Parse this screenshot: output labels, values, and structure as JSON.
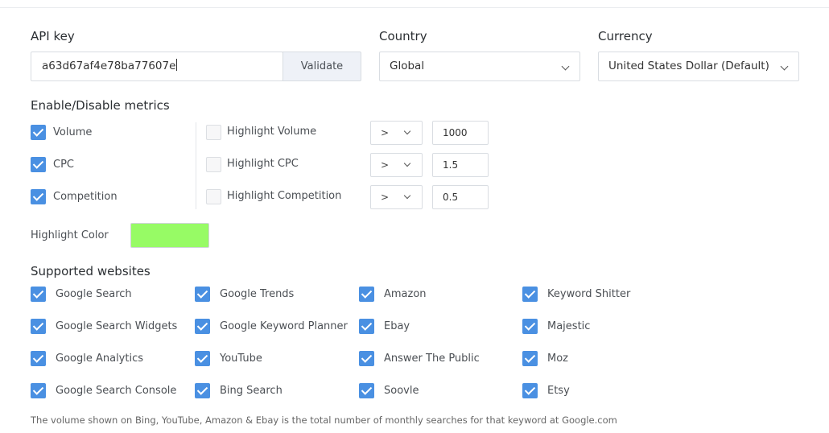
{
  "api": {
    "title": "API key",
    "value": "a63d67af4e78ba77607e",
    "validate_label": "Validate"
  },
  "country": {
    "title": "Country",
    "selected": "Global"
  },
  "currency": {
    "title": "Currency",
    "selected": "United States Dollar (Default)"
  },
  "metrics": {
    "title": "Enable/Disable metrics",
    "items": [
      {
        "label": "Volume",
        "checked": true,
        "highlight_label": "Highlight Volume",
        "highlight_checked": false,
        "operator": ">",
        "threshold": "1000"
      },
      {
        "label": "CPC",
        "checked": true,
        "highlight_label": "Highlight CPC",
        "highlight_checked": false,
        "operator": ">",
        "threshold": "1.5"
      },
      {
        "label": "Competition",
        "checked": true,
        "highlight_label": "Highlight Competition",
        "highlight_checked": false,
        "operator": ">",
        "threshold": "0.5"
      }
    ]
  },
  "highlight_color": {
    "label": "Highlight Color",
    "value": "#97fb65"
  },
  "websites": {
    "title": "Supported websites",
    "columns": [
      [
        {
          "label": "Google Search",
          "checked": true
        },
        {
          "label": "Google Search Widgets",
          "checked": true
        },
        {
          "label": "Google Analytics",
          "checked": true
        },
        {
          "label": "Google Search Console",
          "checked": true
        }
      ],
      [
        {
          "label": "Google Trends",
          "checked": true
        },
        {
          "label": "Google Keyword Planner",
          "checked": true
        },
        {
          "label": "YouTube",
          "checked": true
        },
        {
          "label": "Bing Search",
          "checked": true
        }
      ],
      [
        {
          "label": "Amazon",
          "checked": true
        },
        {
          "label": "Ebay",
          "checked": true
        },
        {
          "label": "Answer The Public",
          "checked": true
        },
        {
          "label": "Soovle",
          "checked": true
        }
      ],
      [
        {
          "label": "Keyword Shitter",
          "checked": true
        },
        {
          "label": "Majestic",
          "checked": true
        },
        {
          "label": "Moz",
          "checked": true
        },
        {
          "label": "Etsy",
          "checked": true
        }
      ]
    ]
  },
  "footer_note": "The volume shown on Bing, YouTube, Amazon & Ebay is the total number of monthly searches for that keyword at Google.com",
  "colors": {
    "accent": "#4a90e2",
    "highlight": "#97fb65"
  }
}
